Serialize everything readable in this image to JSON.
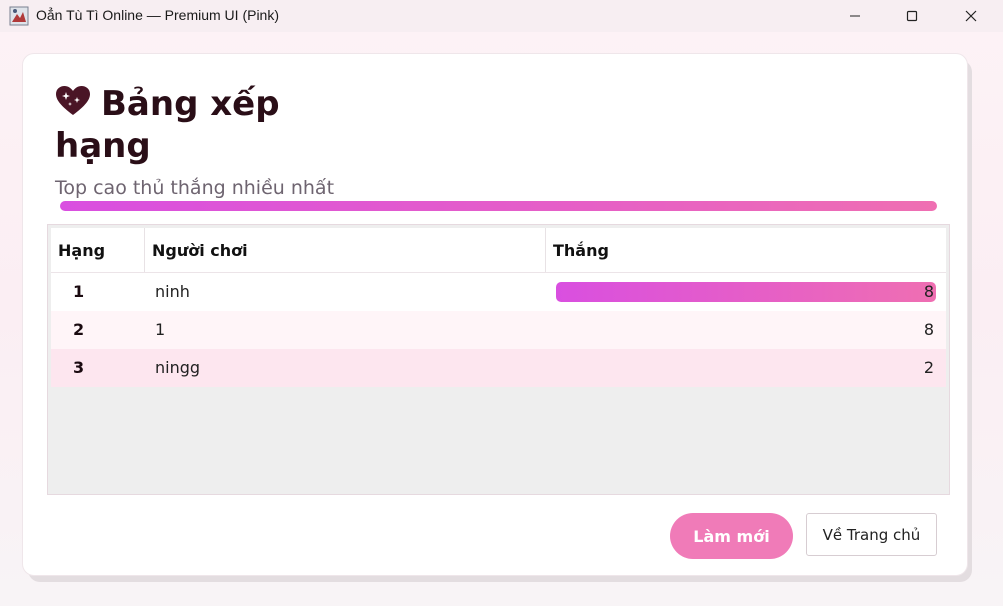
{
  "window": {
    "title": "Oẳn Tù Tì Online — Premium UI (Pink)"
  },
  "header": {
    "title": "Bảng xếp hạng",
    "subtitle": "Top cao thủ thắng nhiều nhất",
    "icon": "sparkling-heart-icon"
  },
  "table": {
    "columns": [
      "Hạng",
      "Người chơi",
      "Thắng"
    ],
    "rows": [
      {
        "rank": "1",
        "player": "ninh",
        "wins": "8",
        "win_fraction": 1.0
      },
      {
        "rank": "2",
        "player": "1",
        "wins": "8",
        "win_fraction": 0
      },
      {
        "rank": "3",
        "player": "ningg",
        "wins": "2",
        "win_fraction": 0
      }
    ]
  },
  "buttons": {
    "refresh_label": "Làm mới",
    "home_label": "Về Trang chủ"
  },
  "colors": {
    "accent_start": "#d94fe0",
    "accent_end": "#ef6fb2",
    "refresh_button": "#f07bb8"
  }
}
